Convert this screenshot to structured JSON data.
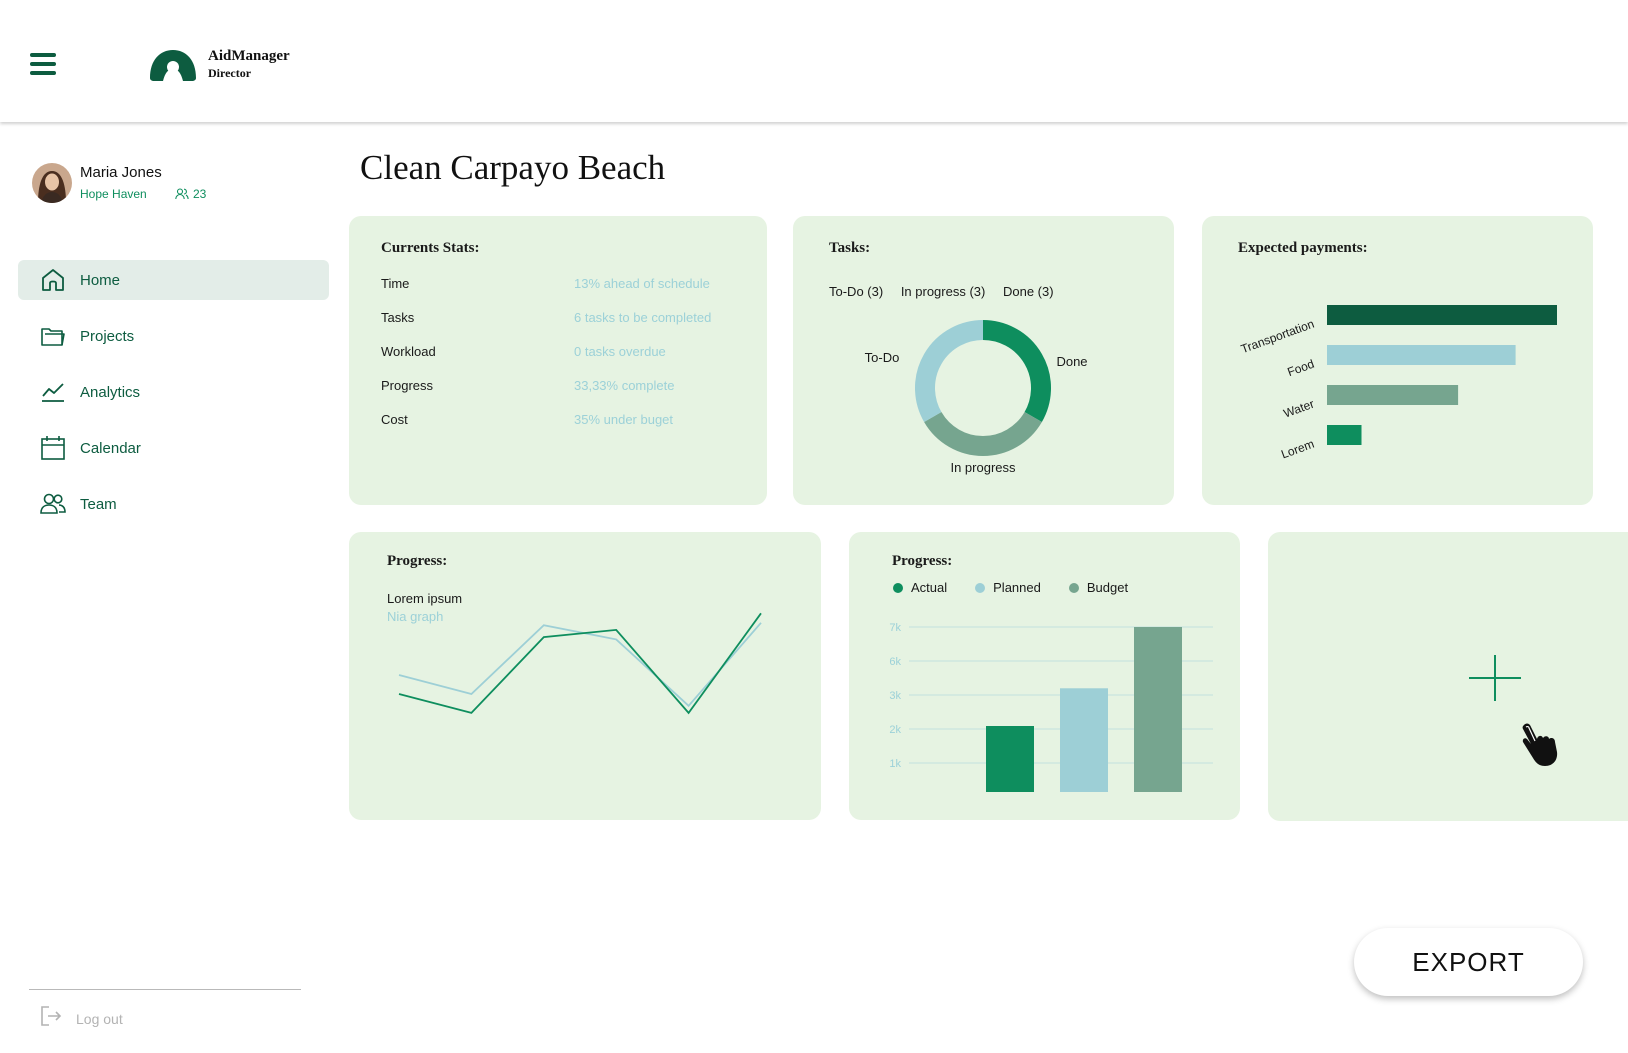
{
  "app": {
    "brand_name": "AidManager",
    "brand_role": "Director",
    "colors": {
      "primary": "#0d5c40",
      "accent": "#0e8e5e",
      "card_bg": "#e6f3e2",
      "light_blue": "#9dcfd6",
      "muted_green": "#76a58f"
    }
  },
  "profile": {
    "name": "Maria Jones",
    "organization": "Hope Haven",
    "members_count": "23"
  },
  "sidebar": {
    "items": [
      {
        "label": "Home",
        "icon": "home-icon",
        "active": true
      },
      {
        "label": "Projects",
        "icon": "folder-icon",
        "active": false
      },
      {
        "label": "Analytics",
        "icon": "analytics-icon",
        "active": false
      },
      {
        "label": "Calendar",
        "icon": "calendar-icon",
        "active": false
      },
      {
        "label": "Team",
        "icon": "team-icon",
        "active": false
      }
    ],
    "logout_label": "Log out"
  },
  "main": {
    "title": "Clean Carpayo Beach",
    "export_label": "EXPORT"
  },
  "stats_card": {
    "title": "Currents Stats:",
    "rows": [
      {
        "key": "Time",
        "value": "13% ahead of schedule"
      },
      {
        "key": "Tasks",
        "value": "6 tasks to be completed"
      },
      {
        "key": "Workload",
        "value": "0 tasks overdue"
      },
      {
        "key": "Progress",
        "value": "33,33% complete"
      },
      {
        "key": "Cost",
        "value": "35% under buget"
      }
    ]
  },
  "tasks_card": {
    "title": "Tasks:",
    "legend": [
      "To-Do (3)",
      "In progress (3)",
      "Done (3)"
    ]
  },
  "payments_card": {
    "title": "Expected payments:"
  },
  "progress_line_card": {
    "title": "Progress:",
    "subtitle": "Lorem ipsum",
    "subtitle2": "Nia graph"
  },
  "progress_bar_card": {
    "title": "Progress:"
  },
  "chart_data": [
    {
      "type": "pie",
      "variant": "donut",
      "labels": [
        "To-Do",
        "Done",
        "In progress"
      ],
      "values": [
        3,
        3,
        3
      ],
      "colors": [
        "#9dcfd6",
        "#0e8e5e",
        "#76a58f"
      ]
    },
    {
      "type": "bar",
      "orientation": "horizontal",
      "categories": [
        "Transportation",
        "Food",
        "Water",
        "Lorem"
      ],
      "values": [
        100,
        82,
        57,
        15
      ],
      "colors": [
        "#0d5c40",
        "#9dcfd6",
        "#76a58f",
        "#0e8e5e"
      ],
      "xlim": [
        0,
        100
      ]
    },
    {
      "type": "line",
      "x": [
        0,
        1,
        2,
        3,
        4,
        5
      ],
      "series": [
        {
          "values": [
            3.5,
            2.7,
            5.6,
            5.0,
            2.2,
            5.7
          ],
          "color": "#9dcfd6"
        },
        {
          "values": [
            2.7,
            1.9,
            5.1,
            5.4,
            1.9,
            6.1
          ],
          "color": "#0e8e5e"
        }
      ],
      "ylim": [
        0,
        7
      ]
    },
    {
      "type": "bar",
      "categories": [
        "Actual",
        "Planned",
        "Budget"
      ],
      "series": [
        {
          "name": "Actual",
          "value": 2.8,
          "color": "#0e8e5e"
        },
        {
          "name": "Planned",
          "value": 4.4,
          "color": "#9dcfd6"
        },
        {
          "name": "Budget",
          "value": 7.0,
          "color": "#76a58f"
        }
      ],
      "yticks": [
        "1k",
        "2k",
        "3k",
        "6k",
        "7k"
      ],
      "ylim": [
        0,
        7.9
      ]
    }
  ]
}
